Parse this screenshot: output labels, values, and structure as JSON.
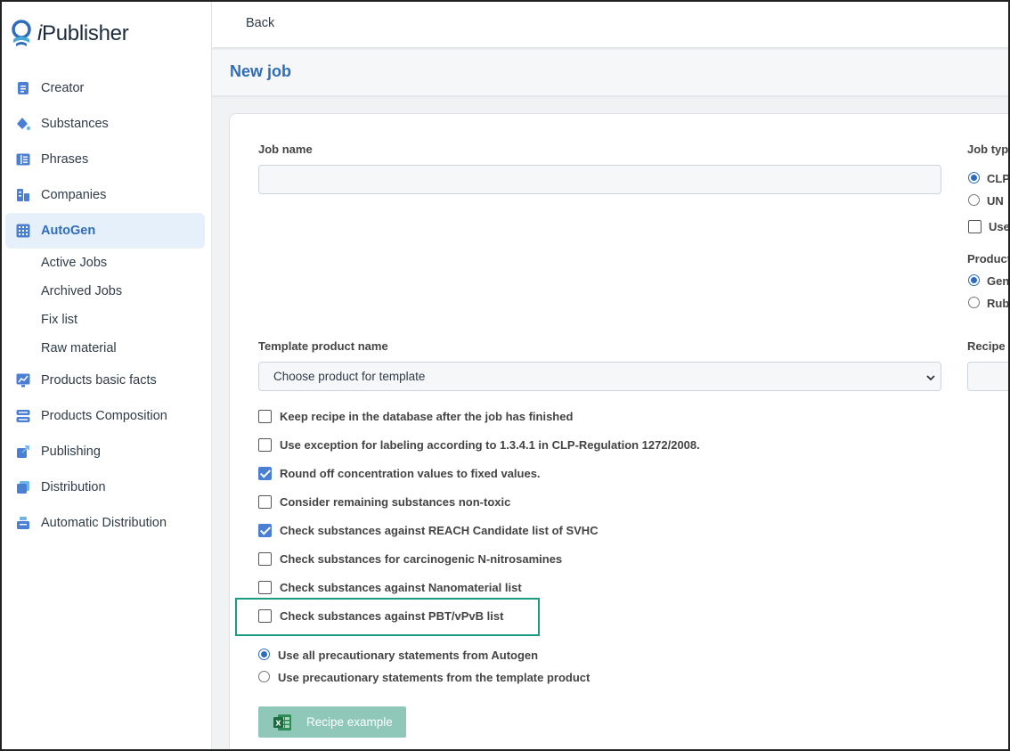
{
  "app": {
    "logo_prefix": "i",
    "logo_text": "Publisher"
  },
  "sidebar": {
    "items": [
      {
        "label": "Creator",
        "icon": "document-icon"
      },
      {
        "label": "Substances",
        "icon": "droplet-icon"
      },
      {
        "label": "Phrases",
        "icon": "list-icon"
      },
      {
        "label": "Companies",
        "icon": "building-icon"
      },
      {
        "label": "AutoGen",
        "icon": "grid-icon",
        "active": true
      }
    ],
    "subitems": [
      "Active Jobs",
      "Archived Jobs",
      "Fix list",
      "Raw material"
    ],
    "items_after": [
      {
        "label": "Products basic facts",
        "icon": "chart-icon"
      },
      {
        "label": "Products Composition",
        "icon": "layers-icon"
      },
      {
        "label": "Publishing",
        "icon": "publish-icon"
      },
      {
        "label": "Distribution",
        "icon": "copy-icon"
      },
      {
        "label": "Automatic Distribution",
        "icon": "tray-icon"
      }
    ]
  },
  "topbar": {
    "back_label": "Back"
  },
  "header": {
    "title": "New job"
  },
  "form": {
    "job_name_label": "Job name",
    "job_name_value": "",
    "template_label": "Template product name",
    "template_selected": "Choose product for template",
    "recipe_label": "Recipe",
    "job_type_label": "Job typ",
    "job_type_options": [
      {
        "label": "CLP",
        "selected": true
      },
      {
        "label": "UN",
        "selected": false
      }
    ],
    "use_checkbox_label": "Use",
    "product_label": "Product",
    "product_options": [
      {
        "label": "Gen",
        "selected": true
      },
      {
        "label": "Rub",
        "selected": false
      }
    ],
    "checkboxes": [
      {
        "label": "Keep recipe in the database after the job has finished",
        "checked": false
      },
      {
        "label": "Use exception for labeling according to 1.3.4.1 in CLP-Regulation 1272/2008.",
        "checked": false
      },
      {
        "label": "Round off concentration values to fixed values.",
        "checked": true
      },
      {
        "label": "Consider remaining substances non-toxic",
        "checked": false
      },
      {
        "label": "Check substances against REACH Candidate list of SVHC",
        "checked": true
      },
      {
        "label": "Check substances for carcinogenic N-nitrosamines",
        "checked": false
      },
      {
        "label": "Check substances against Nanomaterial list",
        "checked": false
      },
      {
        "label": "Check substances against PBT/vPvB list",
        "checked": false
      }
    ],
    "precautionary_options": [
      {
        "label": "Use all precautionary statements from Autogen",
        "selected": true
      },
      {
        "label": "Use precautionary statements from the template product",
        "selected": false
      }
    ],
    "recipe_button_label": "Recipe example"
  },
  "colors": {
    "accent": "#2f6dbb",
    "highlight_border": "#1a9c84",
    "recipe_button": "#8fc7b9"
  }
}
